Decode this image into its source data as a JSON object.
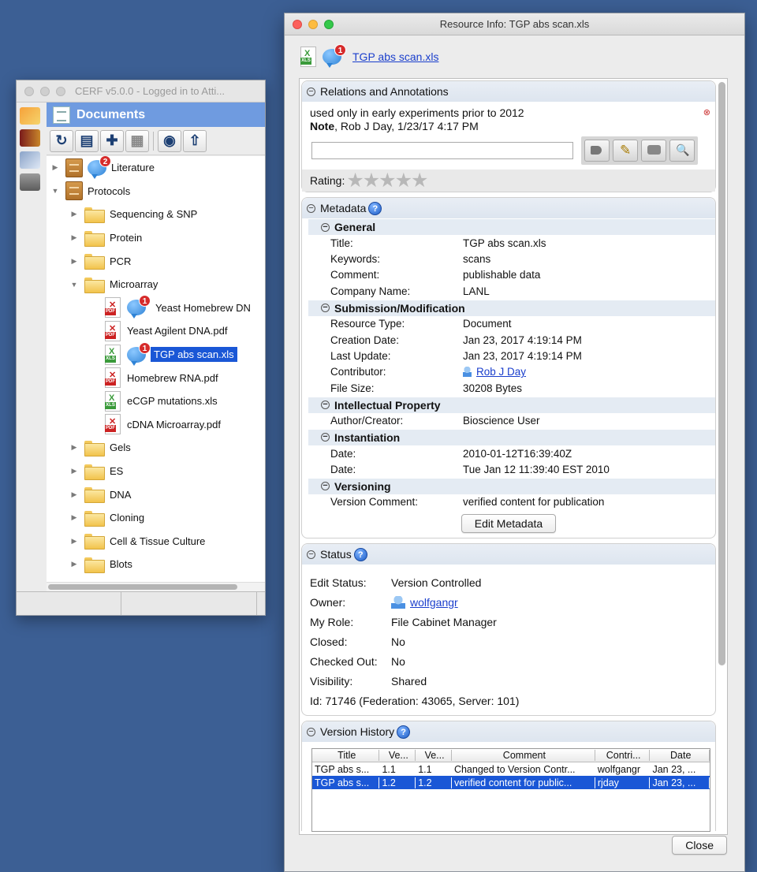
{
  "cerf": {
    "title": "CERF v5.0.0 - Logged in to Atti...",
    "documents_label": "Documents",
    "tree": {
      "literature": {
        "label": "Literature",
        "badge": "2"
      },
      "protocols": {
        "label": "Protocols"
      },
      "folders_before": [
        "Sequencing & SNP",
        "Protein",
        "PCR"
      ],
      "microarray": "Microarray",
      "files": [
        {
          "name": "Yeast Homebrew DN",
          "type": "pdf",
          "badge": "1"
        },
        {
          "name": "Yeast Agilent DNA.pdf",
          "type": "pdf"
        },
        {
          "name": "TGP abs scan.xls",
          "type": "xls",
          "badge": "1",
          "selected": true
        },
        {
          "name": "Homebrew RNA.pdf",
          "type": "pdf"
        },
        {
          "name": "eCGP mutations.xls",
          "type": "xls"
        },
        {
          "name": "cDNA Microarray.pdf",
          "type": "pdf"
        }
      ],
      "folders_after": [
        "Gels",
        "ES",
        "DNA",
        "Cloning",
        "Cell & Tissue Culture",
        "Blots"
      ]
    }
  },
  "resource": {
    "window_title": "Resource Info: TGP abs scan.xls",
    "file_link": "TGP abs scan.xls",
    "file_badge": "1",
    "relations": {
      "title": "Relations and Annotations",
      "annotation_text": "used only in early experiments prior to 2012",
      "note_prefix": "Note",
      "note_meta": ", Rob J Day, 1/23/17 4:17 PM",
      "rating_label": "Rating:"
    },
    "metadata": {
      "title": "Metadata",
      "general": {
        "title": "General",
        "rows": [
          {
            "k": "Title:",
            "v": "TGP abs scan.xls"
          },
          {
            "k": "Keywords:",
            "v": "scans"
          },
          {
            "k": "Comment:",
            "v": "publishable data"
          },
          {
            "k": "Company Name:",
            "v": "LANL"
          }
        ]
      },
      "submission": {
        "title": "Submission/Modification",
        "rows": [
          {
            "k": "Resource Type:",
            "v": "Document"
          },
          {
            "k": "Creation Date:",
            "v": "Jan 23, 2017 4:19:14 PM"
          },
          {
            "k": "Last Update:",
            "v": "Jan 23, 2017 4:19:14 PM"
          }
        ],
        "contributor_label": "Contributor:",
        "contributor_value": "Rob J Day",
        "filesize_label": "File Size:",
        "filesize_value": "30208 Bytes"
      },
      "ip": {
        "title": "Intellectual Property",
        "rows": [
          {
            "k": "Author/Creator:",
            "v": "Bioscience User"
          }
        ]
      },
      "instantiation": {
        "title": "Instantiation",
        "rows": [
          {
            "k": "Date:",
            "v": "2010-01-12T16:39:40Z"
          },
          {
            "k": "Date:",
            "v": "Tue Jan 12 11:39:40 EST 2010"
          }
        ]
      },
      "versioning": {
        "title": "Versioning",
        "rows": [
          {
            "k": "Version Comment:",
            "v": "verified content for publication"
          }
        ]
      },
      "edit_button": "Edit Metadata"
    },
    "status": {
      "title": "Status",
      "edit_status_label": "Edit Status:",
      "edit_status_value": "Version Controlled",
      "owner_label": "Owner:",
      "owner_value": "wolfgangr",
      "role_label": "My Role:",
      "role_value": "File Cabinet Manager",
      "closed_label": "Closed:",
      "closed_value": "No",
      "checked_label": "Checked Out:",
      "checked_value": "No",
      "visibility_label": "Visibility:",
      "visibility_value": "Shared",
      "id_line": "Id: 71746 (Federation: 43065, Server: 101)"
    },
    "version_history": {
      "title": "Version History",
      "columns": [
        "Title",
        "Ve...",
        "Ve...",
        "Comment",
        "Contri...",
        "Date"
      ],
      "rows": [
        [
          "TGP abs s...",
          "1.1",
          "1.1",
          "Changed to Version Contr...",
          "wolfgangr",
          "Jan 23, ..."
        ],
        [
          "TGP abs s...",
          "1.2",
          "1.2",
          "verified content for public...",
          "rjday",
          "Jan 23, ..."
        ]
      ]
    },
    "close_button": "Close"
  }
}
